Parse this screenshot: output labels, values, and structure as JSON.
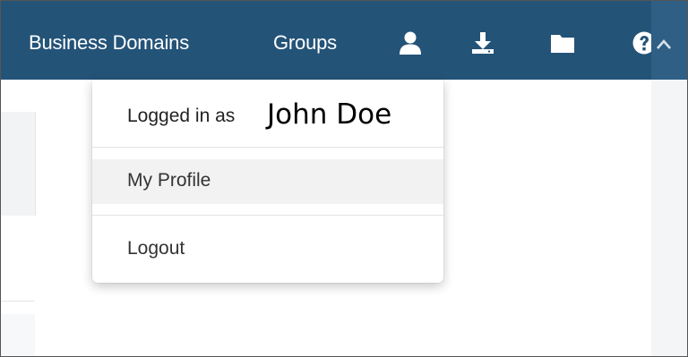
{
  "navbar": {
    "links": {
      "business_domains": "Business Domains",
      "groups": "Groups"
    },
    "icons": {
      "user": "user-icon",
      "download": "download-icon",
      "folder": "folder-icon",
      "help": "help-icon",
      "caret": "chevron-up-icon"
    },
    "background_color": "#245378"
  },
  "user_menu": {
    "logged_in_prefix": "Logged in as",
    "user_name": "John Doe",
    "items": [
      {
        "label": "My Profile",
        "highlighted": true
      },
      {
        "label": "Logout",
        "highlighted": false
      }
    ]
  }
}
